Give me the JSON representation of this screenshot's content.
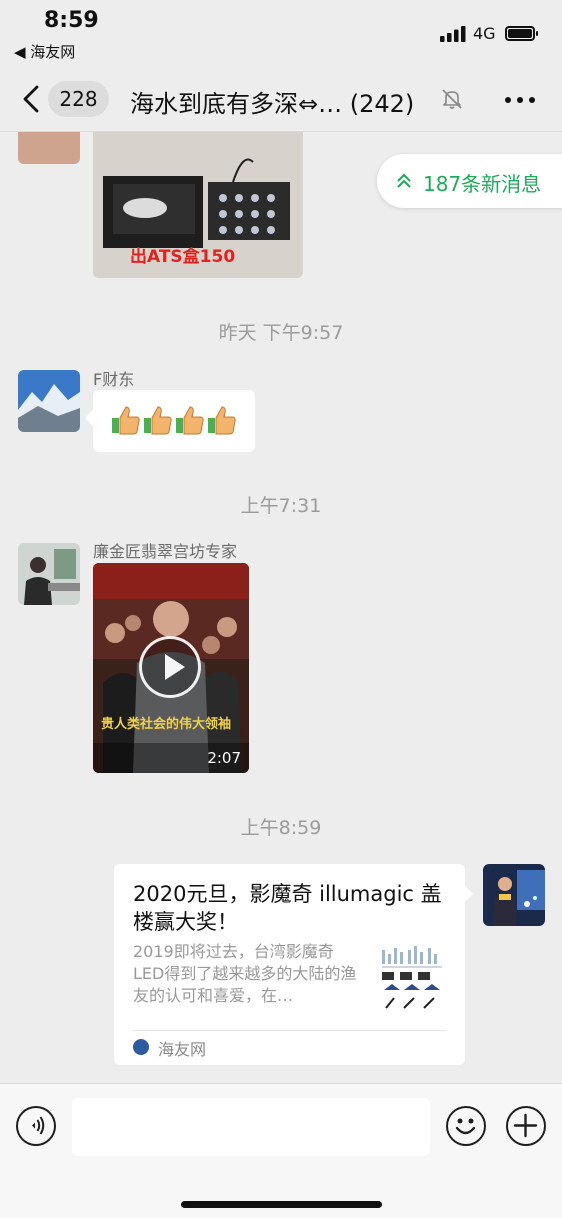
{
  "status": {
    "time": "8:59",
    "back_app": "◀ 海友网",
    "network": "4G"
  },
  "nav": {
    "unread_count": "228",
    "title": "海水到底有多深⇔… (242)"
  },
  "new_messages": {
    "label": "187条新消息",
    "color": "#1aad5a"
  },
  "messages": {
    "photo_caption": "出ATS盒150",
    "ts1": "昨天 下午9:57",
    "sender1": "F财东",
    "ts2": "上午7:31",
    "sender2": "廉金匠翡翠宫坊专家",
    "video_subtitle": "贵人类社会的伟大领袖",
    "video_duration": "2:07",
    "ts3": "上午8:59",
    "link": {
      "title": "2020元旦，影魔奇 illumagic 盖楼赢大奖！",
      "description": "2019即将过去，台湾影魔奇LED得到了越来越多的大陆的渔友的认可和喜爱，在…",
      "source": "海友网"
    }
  },
  "input": {
    "placeholder": ""
  },
  "icons": [
    "back-chevron-icon",
    "mute-bell-icon",
    "more-icon",
    "double-chevron-up-icon",
    "thumbs-up-icon",
    "play-icon",
    "voice-icon",
    "emoji-icon",
    "plus-icon"
  ]
}
